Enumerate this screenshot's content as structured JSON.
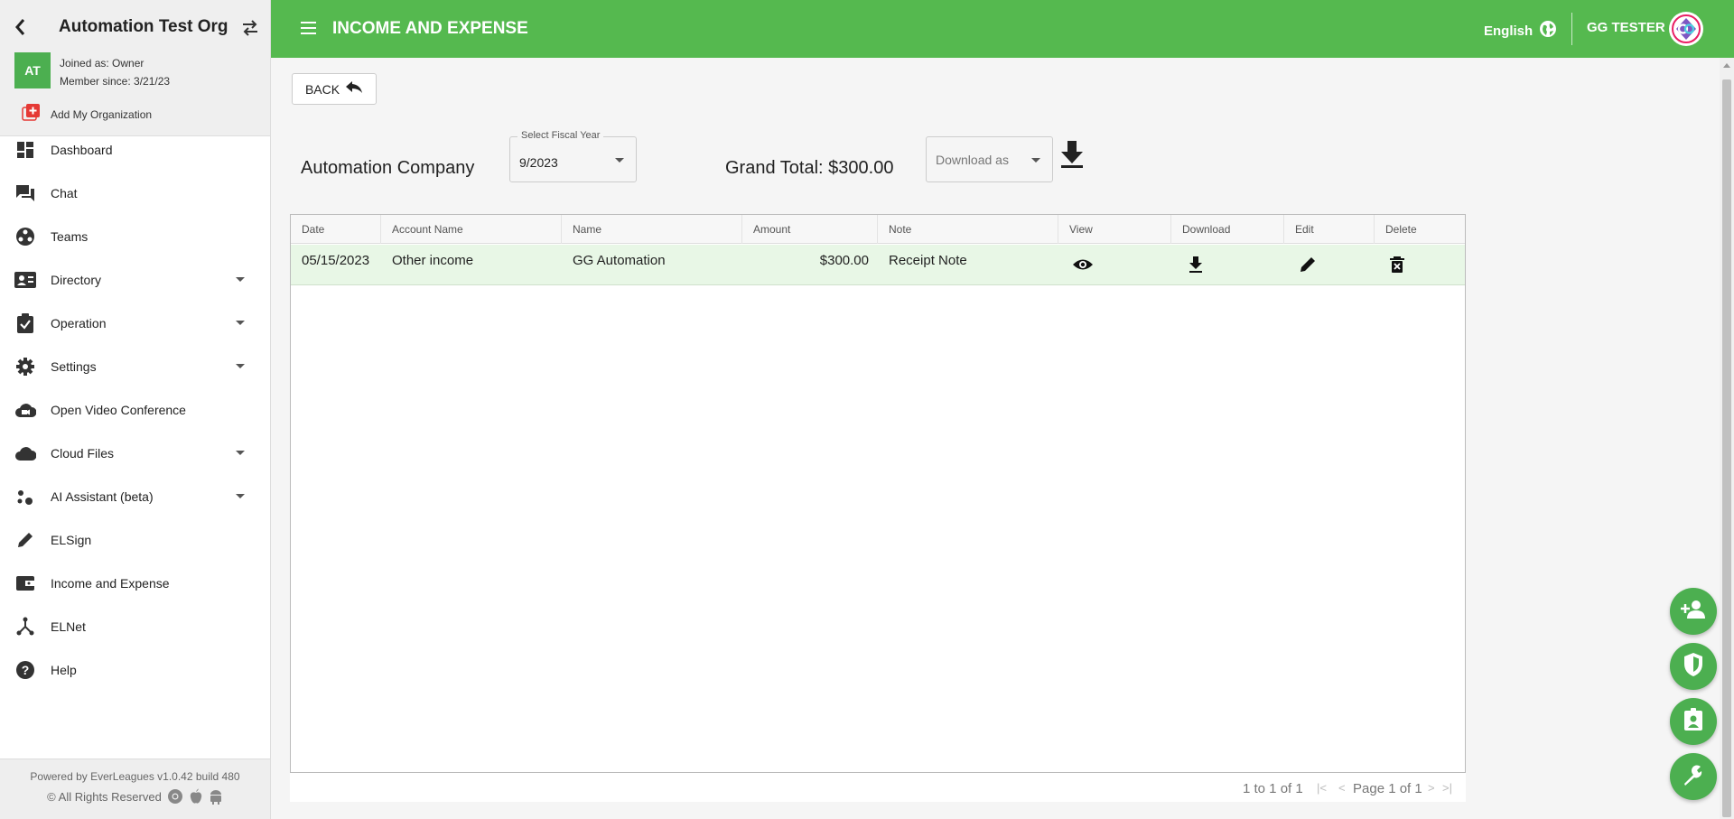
{
  "sidebar": {
    "org_name": "Automation Test Org",
    "avatar_initials": "AT",
    "joined_as": "Joined as: Owner",
    "member_since": "Member since: 3/21/23",
    "add_org_label": "Add My Organization",
    "items": [
      {
        "label": "Dashboard",
        "icon": "dashboard-icon",
        "expandable": false
      },
      {
        "label": "Chat",
        "icon": "chat-icon",
        "expandable": false
      },
      {
        "label": "Teams",
        "icon": "teams-icon",
        "expandable": false
      },
      {
        "label": "Directory",
        "icon": "contact-card-icon",
        "expandable": true
      },
      {
        "label": "Operation",
        "icon": "clipboard-check-icon",
        "expandable": true
      },
      {
        "label": "Settings",
        "icon": "gear-icon",
        "expandable": true
      },
      {
        "label": "Open Video Conference",
        "icon": "cloud-video-icon",
        "expandable": false
      },
      {
        "label": "Cloud Files",
        "icon": "cloud-icon",
        "expandable": true
      },
      {
        "label": "AI Assistant (beta)",
        "icon": "bubbles-icon",
        "expandable": true
      },
      {
        "label": "ELSign",
        "icon": "pen-icon",
        "expandable": false
      },
      {
        "label": "Income and Expense",
        "icon": "wallet-icon",
        "expandable": false
      },
      {
        "label": "ELNet",
        "icon": "network-icon",
        "expandable": false
      },
      {
        "label": "Help",
        "icon": "help-icon",
        "expandable": false
      }
    ],
    "footer": {
      "powered_by": "Powered by EverLeagues v1.0.42 build 480",
      "rights": "© All Rights Reserved"
    }
  },
  "topbar": {
    "title": "INCOME AND EXPENSE",
    "language": "English",
    "user_name": "GG TESTER",
    "color": "#55b94f"
  },
  "main": {
    "back_label": "BACK",
    "company_name": "Automation Company",
    "fiscal_year": {
      "label": "Select Fiscal Year",
      "value": "9/2023"
    },
    "grand_total": "Grand Total: $300.00",
    "download_placeholder": "Download as"
  },
  "table": {
    "headers": [
      "Date",
      "Account Name",
      "Name",
      "Amount",
      "Note",
      "View",
      "Download",
      "Edit",
      "Delete"
    ],
    "rows": [
      {
        "date": "05/15/2023",
        "account_name": "Other income",
        "name": "GG Automation",
        "amount": "$300.00",
        "note": "Receipt Note"
      }
    ]
  },
  "pagination": {
    "count": "1 to 1 of 1",
    "page_info": "Page 1 of 1"
  },
  "fabs": [
    "add-user-icon",
    "shield-icon",
    "badge-icon",
    "wrench-icon"
  ]
}
